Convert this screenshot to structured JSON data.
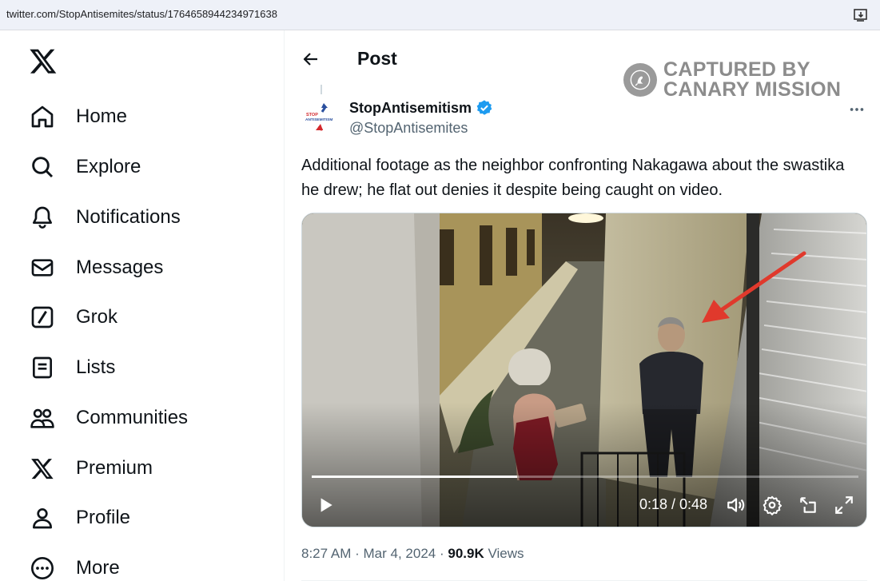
{
  "browser": {
    "url": "twitter.com/StopAntisemites/status/1764658944234971638"
  },
  "nav": {
    "logo": "x-logo-icon",
    "items": [
      {
        "label": "Home",
        "icon": "home-icon"
      },
      {
        "label": "Explore",
        "icon": "search-icon"
      },
      {
        "label": "Notifications",
        "icon": "bell-icon"
      },
      {
        "label": "Messages",
        "icon": "mail-icon"
      },
      {
        "label": "Grok",
        "icon": "grok-icon"
      },
      {
        "label": "Lists",
        "icon": "list-icon"
      },
      {
        "label": "Communities",
        "icon": "people-icon"
      },
      {
        "label": "Premium",
        "icon": "x-logo-icon"
      },
      {
        "label": "Profile",
        "icon": "person-icon"
      },
      {
        "label": "More",
        "icon": "more-circle-icon"
      }
    ]
  },
  "header": {
    "title": "Post"
  },
  "watermark": {
    "line1": "CAPTURED BY",
    "line2": "CANARY MISSION"
  },
  "tweet": {
    "display_name": "StopAntisemitism",
    "handle": "@StopAntisemites",
    "avatar_text_1": "STOP",
    "avatar_text_2": "ANTISEMITISM",
    "text": "Additional footage as the neighbor confronting Nakagawa about the swastika he drew; he flat out denies it despite being caught on video.",
    "time": "8:27 AM",
    "separator": "·",
    "date": "Mar 4, 2024",
    "views_count": "90.9K",
    "views_label": "Views"
  },
  "video": {
    "current_time": "0:18",
    "duration": "0:48",
    "timecode": "0:18 / 0:48",
    "progress": 0.375
  },
  "colors": {
    "verified": "#1d9bf0",
    "arrow": "#e0392c",
    "text_secondary": "#536471"
  }
}
